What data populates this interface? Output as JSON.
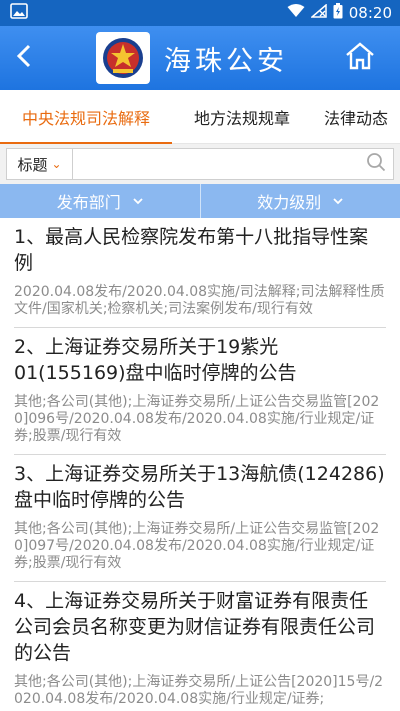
{
  "status_bar": {
    "time": "08:20"
  },
  "header": {
    "title": "海珠公安"
  },
  "tabs": [
    {
      "label": "中央法规司法解释",
      "active": true
    },
    {
      "label": "地方法规规章",
      "active": false
    },
    {
      "label": "法律动态",
      "active": false
    }
  ],
  "search": {
    "type_label": "标题",
    "placeholder": ""
  },
  "filters": [
    {
      "label": "发布部门"
    },
    {
      "label": "效力级别"
    }
  ],
  "items": [
    {
      "title": "1、最高人民检察院发布第十八批指导性案例",
      "meta": "2020.04.08发布/2020.04.08实施/司法解释;司法解释性质文件/国家机关;检察机关;司法案例发布/现行有效"
    },
    {
      "title": "2、上海证券交易所关于19紫光01(155169)盘中临时停牌的公告",
      "meta": "其他;各公司(其他);上海证券交易所/上证公告交易监管[2020]096号/2020.04.08发布/2020.04.08实施/行业规定/证券;股票/现行有效"
    },
    {
      "title": "3、上海证券交易所关于13海航债(124286)盘中临时停牌的公告",
      "meta": "其他;各公司(其他);上海证券交易所/上证公告交易监管[2020]097号/2020.04.08发布/2020.04.08实施/行业规定/证券;股票/现行有效"
    },
    {
      "title": "4、上海证券交易所关于财富证券有限责任公司会员名称变更为财信证券有限责任公司的公告",
      "meta": "其他;各公司(其他);上海证券交易所/上证公告[2020]15号/2020.04.08发布/2020.04.08实施/行业规定/证券;"
    }
  ]
}
